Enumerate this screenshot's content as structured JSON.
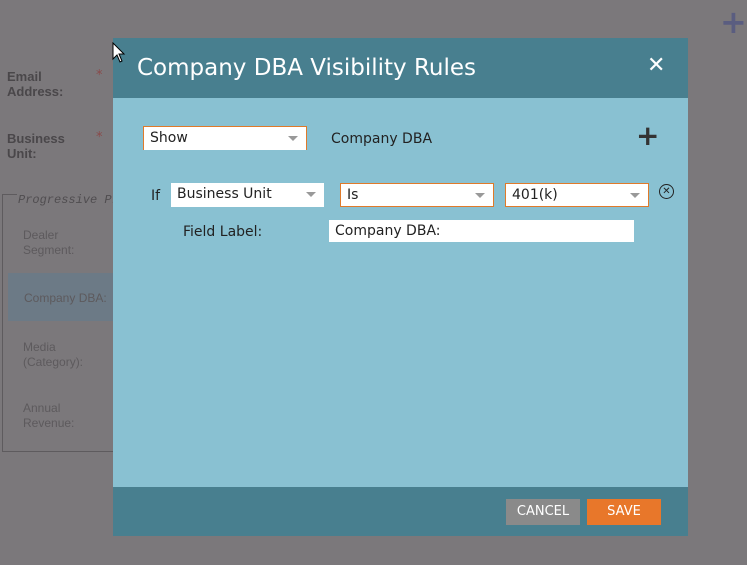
{
  "background_form": {
    "email_label": "Email Address:",
    "business_unit_label": "Business Unit:",
    "required_mark": "*",
    "fieldset_legend": "Progressive Pr",
    "fields": [
      "Dealer Segment:",
      "Company DBA:",
      "Media (Category):",
      "Annual Revenue:"
    ],
    "add_icon": "plus-icon"
  },
  "modal": {
    "title": "Company DBA Visibility Rules",
    "close_icon": "close-icon",
    "action_select": "Show",
    "target_field": "Company DBA",
    "add_rule_icon": "plus-icon",
    "rule": {
      "if_label": "If",
      "field": "Business Unit",
      "operator": "Is",
      "value": "401(k)",
      "remove_icon": "circle-x-icon"
    },
    "field_label_label": "Field Label:",
    "field_label_value": "Company DBA:",
    "cancel": "CANCEL",
    "save": "SAVE"
  },
  "colors": {
    "header": "#487f8f",
    "body": "#89c1d2",
    "save": "#e8772a",
    "cancel": "#8a8a8a"
  }
}
